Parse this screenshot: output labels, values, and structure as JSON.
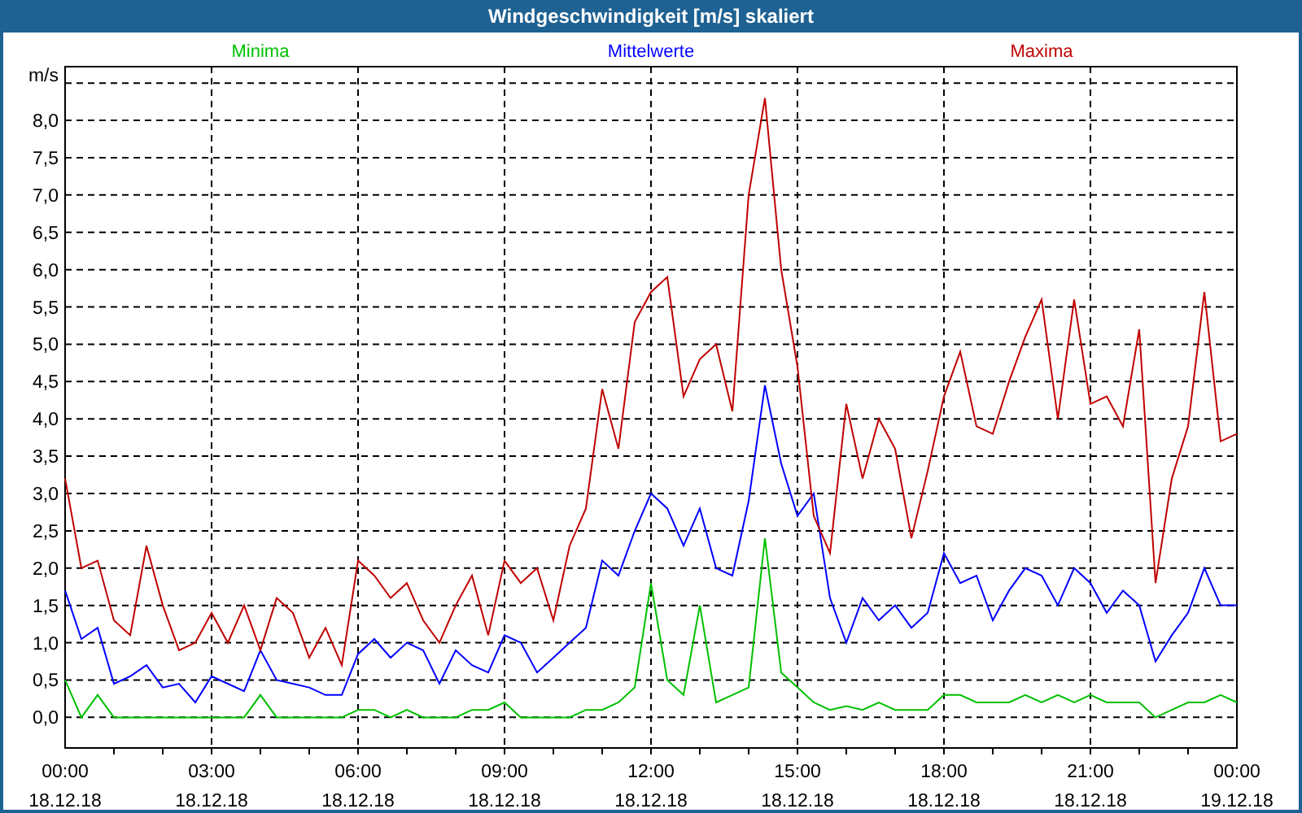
{
  "chart": {
    "chart_data": {
      "type": "line",
      "title": "Windgeschwindigkeit [m/s] skaliert",
      "ylabel": "m/s",
      "categories": [
        "00:00\n18.12.18",
        null,
        null,
        null,
        null,
        null,
        null,
        null,
        null,
        "03:00\n18.12.18",
        null,
        null,
        null,
        null,
        null,
        null,
        null,
        null,
        "06:00\n18.12.18",
        null,
        null,
        null,
        null,
        null,
        null,
        null,
        null,
        "09:00\n18.12.18",
        null,
        null,
        null,
        null,
        null,
        null,
        null,
        null,
        "12:00\n18.12.18",
        null,
        null,
        null,
        null,
        null,
        null,
        null,
        null,
        "15:00\n18.12.18",
        null,
        null,
        null,
        null,
        null,
        null,
        null,
        null,
        "18:00\n18.12.18",
        null,
        null,
        null,
        null,
        null,
        null,
        null,
        null,
        "21:00\n18.12.18",
        null,
        null,
        null,
        null,
        null,
        null,
        null,
        null,
        "00:00\n19.12.18"
      ],
      "series": [
        {
          "name": "Minima",
          "color": "#00c000",
          "values": [
            0.5,
            0,
            0.3,
            0,
            0,
            0,
            0,
            0,
            0,
            0,
            0,
            0,
            0.3,
            0,
            0,
            0,
            0,
            0,
            0.1,
            0.1,
            0,
            0.1,
            0,
            0,
            0,
            0.1,
            0.1,
            0.2,
            0,
            0,
            0,
            0,
            0.1,
            0.1,
            0.2,
            0.4,
            1.8,
            0.5,
            0.3,
            1.5,
            0.2,
            0.3,
            0.4,
            2.4,
            0.6,
            0.4,
            0.2,
            0.1,
            0.15,
            0.1,
            0.2,
            0.1,
            0.1,
            0.1,
            0.3,
            0.3,
            0.2,
            0.2,
            0.2,
            0.3,
            0.2,
            0.3,
            0.2,
            0.3,
            0.2,
            0.2,
            0.2,
            0,
            0.1,
            0.2,
            0.2,
            0.3,
            0.2
          ]
        },
        {
          "name": "Mittelwerte",
          "color": "#0000ff",
          "values": [
            1.7,
            1.05,
            1.2,
            0.45,
            0.55,
            0.7,
            0.4,
            0.45,
            0.2,
            0.55,
            0.45,
            0.35,
            0.9,
            0.5,
            0.45,
            0.4,
            0.3,
            0.3,
            0.85,
            1.05,
            0.8,
            1.0,
            0.9,
            0.45,
            0.9,
            0.7,
            0.6,
            1.1,
            1.0,
            0.6,
            0.8,
            1.0,
            1.2,
            2.1,
            1.9,
            2.5,
            3.0,
            2.8,
            2.3,
            2.8,
            2.0,
            1.9,
            2.9,
            4.45,
            3.4,
            2.7,
            3.0,
            1.6,
            1.0,
            1.6,
            1.3,
            1.5,
            1.2,
            1.4,
            2.2,
            1.8,
            1.9,
            1.3,
            1.7,
            2.0,
            1.9,
            1.5,
            2.0,
            1.8,
            1.4,
            1.7,
            1.5,
            0.75,
            1.1,
            1.4,
            2.0,
            1.5,
            1.5
          ]
        },
        {
          "name": "Maxima",
          "color": "#c00000",
          "values": [
            3.2,
            2.0,
            2.1,
            1.3,
            1.1,
            2.3,
            1.5,
            0.9,
            1.0,
            1.4,
            1.0,
            1.5,
            0.9,
            1.6,
            1.4,
            0.8,
            1.2,
            0.7,
            2.1,
            1.9,
            1.6,
            1.8,
            1.3,
            1.0,
            1.5,
            1.9,
            1.1,
            2.1,
            1.8,
            2.0,
            1.3,
            2.3,
            2.8,
            4.4,
            3.6,
            5.3,
            5.7,
            5.9,
            4.3,
            4.8,
            5.0,
            4.1,
            7.0,
            8.3,
            6.0,
            4.7,
            2.7,
            2.2,
            4.2,
            3.2,
            4.0,
            3.6,
            2.4,
            3.3,
            4.3,
            4.9,
            3.9,
            3.8,
            4.5,
            5.1,
            5.6,
            4.0,
            5.6,
            4.2,
            4.3,
            3.9,
            5.2,
            1.8,
            3.2,
            3.9,
            5.7,
            3.7,
            3.8
          ]
        }
      ],
      "ylim": [
        -0.41,
        8.72
      ],
      "grid": true,
      "yticks": [
        {
          "value": 0,
          "label": "0,0"
        },
        {
          "value": 0.5,
          "label": "0,5"
        },
        {
          "value": 1,
          "label": "1,0"
        },
        {
          "value": 1.5,
          "label": "1,5"
        },
        {
          "value": 2,
          "label": "2,0"
        },
        {
          "value": 2.5,
          "label": "2,5"
        },
        {
          "value": 3,
          "label": "3,0"
        },
        {
          "value": 3.5,
          "label": "3,5"
        },
        {
          "value": 4,
          "label": "4,0"
        },
        {
          "value": 4.5,
          "label": "4,5"
        },
        {
          "value": 5,
          "label": "5,0"
        },
        {
          "value": 5.5,
          "label": "5,5"
        },
        {
          "value": 6,
          "label": "6,0"
        },
        {
          "value": 6.5,
          "label": "6,5"
        },
        {
          "value": 7,
          "label": "7,0"
        },
        {
          "value": 7.5,
          "label": "7,5"
        },
        {
          "value": 8,
          "label": "8,0"
        }
      ]
    }
  }
}
